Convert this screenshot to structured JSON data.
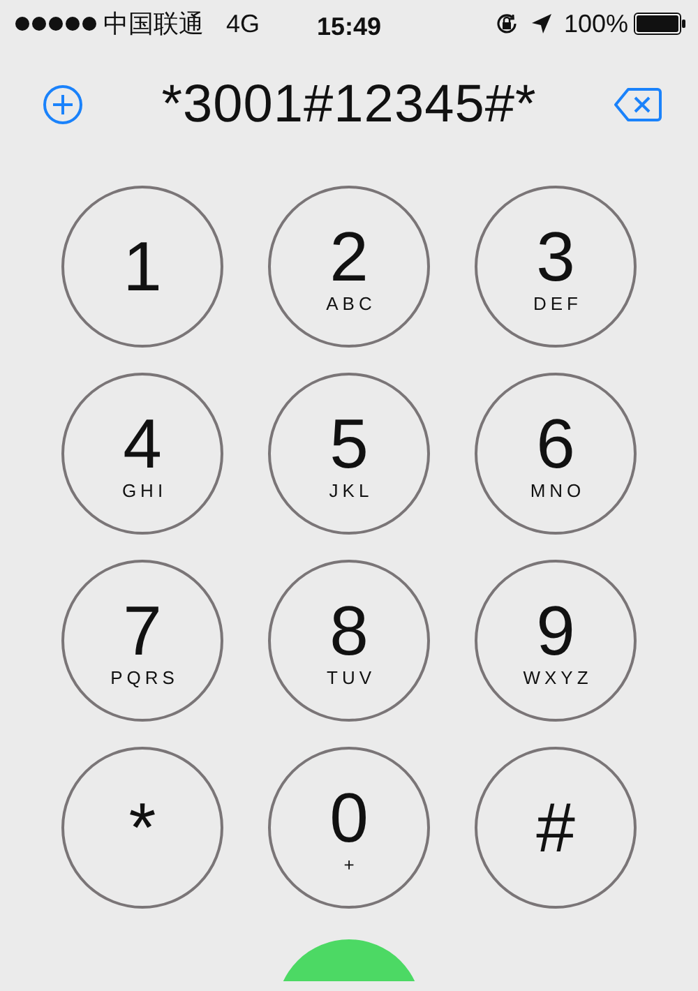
{
  "status_bar": {
    "carrier": "中国联通",
    "network": "4G",
    "time": "15:49",
    "battery_percent": "100%"
  },
  "dialer": {
    "number": "*3001#12345#*"
  },
  "keys": [
    {
      "digit": "1"
    },
    {
      "digit": "2",
      "letters": "ABC"
    },
    {
      "digit": "3",
      "letters": "DEF"
    },
    {
      "digit": "4",
      "letters": "GHI"
    },
    {
      "digit": "5",
      "letters": "JKL"
    },
    {
      "digit": "6",
      "letters": "MNO"
    },
    {
      "digit": "7",
      "letters": "PQRS"
    },
    {
      "digit": "8",
      "letters": "TUV"
    },
    {
      "digit": "9",
      "letters": "WXYZ"
    },
    {
      "digit": "*"
    },
    {
      "digit": "0",
      "letters": "+"
    },
    {
      "digit": "#"
    }
  ]
}
